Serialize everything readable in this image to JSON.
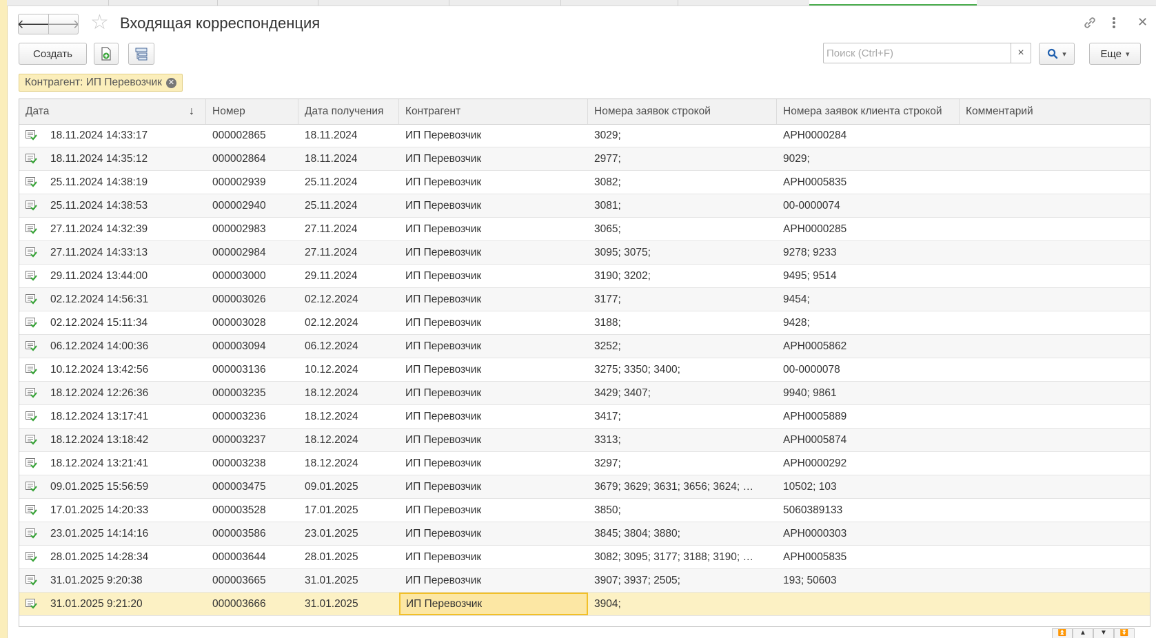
{
  "window": {
    "title": "Входящая корреспонденция",
    "nav_back": "🡐",
    "nav_forward": "🡒"
  },
  "toolbar": {
    "create_label": "Создать",
    "more_label": "Еще",
    "search_placeholder": "Поиск (Ctrl+F)",
    "search_clear": "×",
    "search_icon": "search-icon",
    "search_dropdown": "▾"
  },
  "filter": {
    "label": "Контрагент: ИП Перевозчик",
    "clear": "✕"
  },
  "table": {
    "columns": [
      "Дата",
      "Номер",
      "Дата получения",
      "Контрагент",
      "Номера заявок строкой",
      "Номера заявок клиента строкой",
      "Комментарий"
    ],
    "sort_indicator": "↓",
    "rows": [
      [
        "18.11.2024 14:33:17",
        "000002865",
        "18.11.2024",
        "ИП Перевозчик",
        "3029;",
        "АРН0000284",
        ""
      ],
      [
        "18.11.2024 14:35:12",
        "000002864",
        "18.11.2024",
        "ИП Перевозчик",
        "2977;",
        "9029;",
        ""
      ],
      [
        "25.11.2024 14:38:19",
        "000002939",
        "25.11.2024",
        "ИП Перевозчик",
        "3082;",
        "АРН0005835",
        ""
      ],
      [
        "25.11.2024 14:38:53",
        "000002940",
        "25.11.2024",
        "ИП Перевозчик",
        "3081;",
        "00-0000074",
        ""
      ],
      [
        "27.11.2024 14:32:39",
        "000002983",
        "27.11.2024",
        "ИП Перевозчик",
        "3065;",
        "АРН0000285",
        ""
      ],
      [
        "27.11.2024 14:33:13",
        "000002984",
        "27.11.2024",
        "ИП Перевозчик",
        "3095; 3075;",
        "9278; 9233",
        ""
      ],
      [
        "29.11.2024 13:44:00",
        "000003000",
        "29.11.2024",
        "ИП Перевозчик",
        "3190; 3202;",
        "9495; 9514",
        ""
      ],
      [
        "02.12.2024 14:56:31",
        "000003026",
        "02.12.2024",
        "ИП Перевозчик",
        "3177;",
        "9454;",
        ""
      ],
      [
        "02.12.2024 15:11:34",
        "000003028",
        "02.12.2024",
        "ИП Перевозчик",
        "3188;",
        "9428;",
        ""
      ],
      [
        "06.12.2024 14:00:36",
        "000003094",
        "06.12.2024",
        "ИП Перевозчик",
        "3252;",
        "АРН0005862",
        ""
      ],
      [
        "10.12.2024 13:42:56",
        "000003136",
        "10.12.2024",
        "ИП Перевозчик",
        "3275; 3350; 3400;",
        "00-0000078",
        ""
      ],
      [
        "18.12.2024 12:26:36",
        "000003235",
        "18.12.2024",
        "ИП Перевозчик",
        "3429; 3407;",
        "9940; 9861",
        ""
      ],
      [
        "18.12.2024 13:17:41",
        "000003236",
        "18.12.2024",
        "ИП Перевозчик",
        "3417;",
        "АРН0005889",
        ""
      ],
      [
        "18.12.2024 13:18:42",
        "000003237",
        "18.12.2024",
        "ИП Перевозчик",
        "3313;",
        "АРН0005874",
        ""
      ],
      [
        "18.12.2024 13:21:41",
        "000003238",
        "18.12.2024",
        "ИП Перевозчик",
        "3297;",
        "АРН0000292",
        ""
      ],
      [
        "09.01.2025 15:56:59",
        "000003475",
        "09.01.2025",
        "ИП Перевозчик",
        "3679; 3629; 3631; 3656; 3624; …",
        "10502; 103",
        ""
      ],
      [
        "17.01.2025 14:20:33",
        "000003528",
        "17.01.2025",
        "ИП Перевозчик",
        "3850;",
        "5060389133",
        ""
      ],
      [
        "23.01.2025 14:14:16",
        "000003586",
        "23.01.2025",
        "ИП Перевозчик",
        "3845; 3804; 3880;",
        "АРН0000303",
        ""
      ],
      [
        "28.01.2025 14:28:34",
        "000003644",
        "28.01.2025",
        "ИП Перевозчик",
        "3082; 3095; 3177; 3188; 3190; …",
        "АРН0005835",
        ""
      ],
      [
        "31.01.2025 9:20:38",
        "000003665",
        "31.01.2025",
        "ИП Перевозчик",
        "3907; 3937; 2505;",
        "193; 50603",
        ""
      ],
      [
        "31.01.2025 9:21:20",
        "000003666",
        "31.01.2025",
        "ИП Перевозчик",
        "3904;",
        "",
        ""
      ]
    ],
    "selected_row": 20
  },
  "colors": {
    "accent_green": "#4caf50",
    "filter_tag_bg": "#fbeebb",
    "selected_row_bg": "#fcf1c4",
    "focused_cell_border": "#f2c028",
    "doc_icon_green": "#3aa53a"
  }
}
